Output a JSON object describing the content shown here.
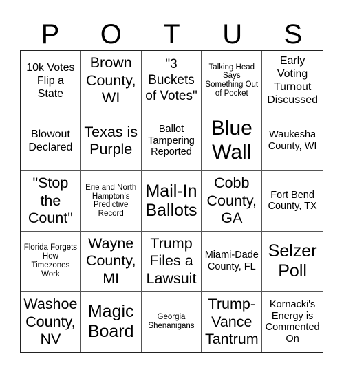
{
  "title_letters": [
    "P",
    "O",
    "T",
    "U",
    "S"
  ],
  "cells": [
    {
      "text": "10k Votes Flip a State",
      "size": "s-m"
    },
    {
      "text": "Brown County, WI",
      "size": "s-xl"
    },
    {
      "text": "\"3 Buckets of Votes\"",
      "size": "s-l"
    },
    {
      "text": "Talking Head Says Something Out of Pocket",
      "size": "s-xs"
    },
    {
      "text": "Early Voting Turnout Discussed",
      "size": "s-m"
    },
    {
      "text": "Blowout Declared",
      "size": "s-m"
    },
    {
      "text": "Texas is Purple",
      "size": "s-xl"
    },
    {
      "text": "Ballot Tampering Reported",
      "size": "s-s"
    },
    {
      "text": "Blue Wall",
      "size": "s-huge"
    },
    {
      "text": "Waukesha County, WI",
      "size": "s-s"
    },
    {
      "text": "\"Stop the Count\"",
      "size": "s-xl"
    },
    {
      "text": "Erie and North Hampton's Predictive Record",
      "size": "s-xs"
    },
    {
      "text": "Mail-In Ballots",
      "size": "s-xxl"
    },
    {
      "text": "Cobb County, GA",
      "size": "s-xl"
    },
    {
      "text": "Fort Bend County, TX",
      "size": "s-s"
    },
    {
      "text": "Florida Forgets How Timezones Work",
      "size": "s-xs"
    },
    {
      "text": "Wayne County, MI",
      "size": "s-xl"
    },
    {
      "text": "Trump Files a Lawsuit",
      "size": "s-xl"
    },
    {
      "text": "Miami-Dade County, FL",
      "size": "s-s"
    },
    {
      "text": "Selzer Poll",
      "size": "s-xxl"
    },
    {
      "text": "Washoe County, NV",
      "size": "s-xl"
    },
    {
      "text": "Magic Board",
      "size": "s-xxl"
    },
    {
      "text": "Georgia Shenanigans",
      "size": "s-xs"
    },
    {
      "text": "Trump-Vance Tantrum",
      "size": "s-xl"
    },
    {
      "text": "Kornacki's Energy is Commented On",
      "size": "s-s"
    }
  ]
}
